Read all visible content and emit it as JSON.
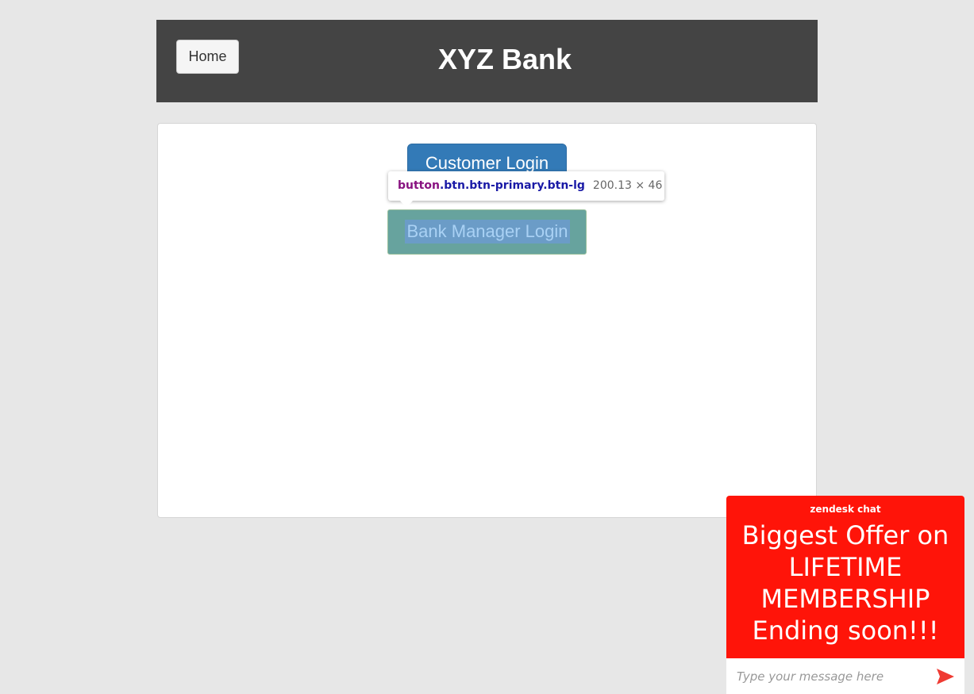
{
  "header": {
    "home_label": "Home",
    "title": "XYZ Bank"
  },
  "login": {
    "customer_label": "Customer Login",
    "manager_label": "Bank Manager Login"
  },
  "inspector_tooltip": {
    "tag": "button",
    "classes": ".btn.btn-primary.btn-lg",
    "size": "200.13 × 46"
  },
  "chat": {
    "brand": "zendesk chat",
    "offer": "Biggest Offer on LIFETIME MEMBERSHIP Ending soon!!!",
    "input_placeholder": "Type your message here",
    "send_icon": "send-icon"
  },
  "colors": {
    "header_bg": "#444444",
    "primary": "#337ab7",
    "chat_red": "#ff1409",
    "send_icon": "#ef3b33"
  }
}
